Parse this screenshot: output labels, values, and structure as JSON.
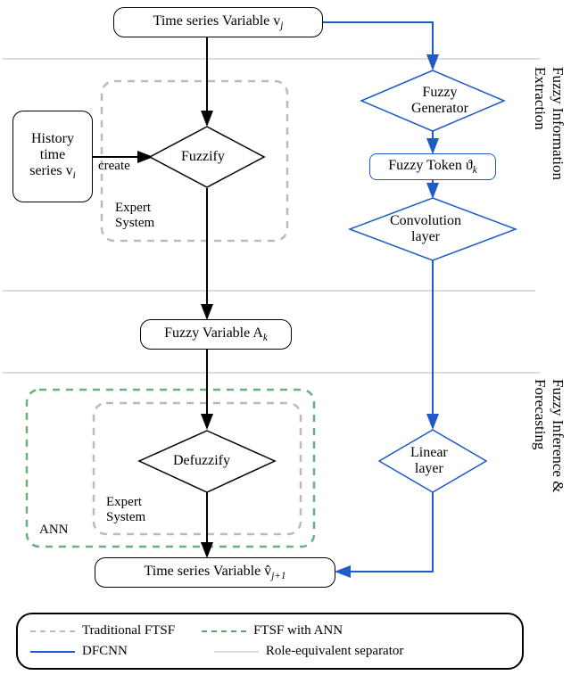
{
  "nodes": {
    "input": "Time series Variable v",
    "input_sub": "j",
    "history": "History\ntime\nseries v",
    "history_sub": "i",
    "fuzzify": "Fuzzify",
    "fuzzy_gen": "Fuzzy\nGenerator",
    "fuzzy_token": "Fuzzy Token ϑ",
    "fuzzy_token_sub": "k",
    "conv": "Convolution\nlayer",
    "fuzzy_var": "Fuzzy Variable A",
    "fuzzy_var_sub": "k",
    "defuzzify": "Defuzzify",
    "linear": "Linear\nlayer",
    "output": "Time series Variable v̂",
    "output_sub": "j+1"
  },
  "labels": {
    "create": "create",
    "expert1": "Expert\nSystem",
    "expert2": "Expert\nSystem",
    "ann": "ANN",
    "side1": "Fuzzy Information\nExtraction",
    "side2": "Fuzzy Inference &\nForecasting"
  },
  "legend": {
    "trad": "Traditional FTSF",
    "ann": "FTSF with ANN",
    "dfcnn": "DFCNN",
    "sep": "Role-equivalent separator"
  }
}
